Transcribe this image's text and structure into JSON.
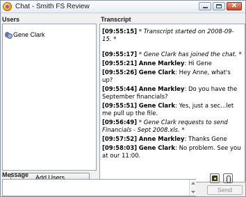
{
  "window": {
    "title": "Chat - Smith FS Review",
    "controls": {
      "minimize": "minimize",
      "maximize": "maximize",
      "close": "close"
    }
  },
  "users": {
    "label": "Users",
    "list": [
      {
        "name": "Gene Clark",
        "icon": "user-icon"
      }
    ],
    "add_button": "Add Users"
  },
  "transcript": {
    "label": "Transcript",
    "lines": [
      {
        "time": "[09:55:15]",
        "speaker": "",
        "text": "* Transcript started on 2008-09-15. *",
        "system": true
      },
      {
        "time": "[09:55:17]",
        "speaker": "",
        "text": "* Gene Clark has joined the chat. *",
        "system": true
      },
      {
        "time": "[09:55:21]",
        "speaker": "Anne Markley",
        "text": "Hi Gene",
        "system": false
      },
      {
        "time": "[09:55:26]",
        "speaker": "Gene Clark",
        "text": "Hey Anne, what's up?",
        "system": false
      },
      {
        "time": "[09:55:44]",
        "speaker": "Anne Markley",
        "text": "Do you have the September financials?",
        "system": false
      },
      {
        "time": "[09:55:51]",
        "speaker": "Gene Clark",
        "text": "Yes, just a sec...let me pull up the file.",
        "system": false
      },
      {
        "time": "[09:56:49]",
        "speaker": "",
        "text": "* Gene Clark requests to send Financials - Sept 2008.xls. *",
        "system": true
      },
      {
        "time": "[09:57:52]",
        "speaker": "Anne Markley",
        "text": "Thanks Gene",
        "system": false
      },
      {
        "time": "[09:58:03]",
        "speaker": "Gene Clark",
        "text": "No problem. See you at our 11:00.",
        "system": false
      }
    ]
  },
  "message": {
    "label": "Message",
    "value": "",
    "send_button": "Send",
    "tools": [
      "send-file-icon",
      "attach-icon"
    ]
  }
}
